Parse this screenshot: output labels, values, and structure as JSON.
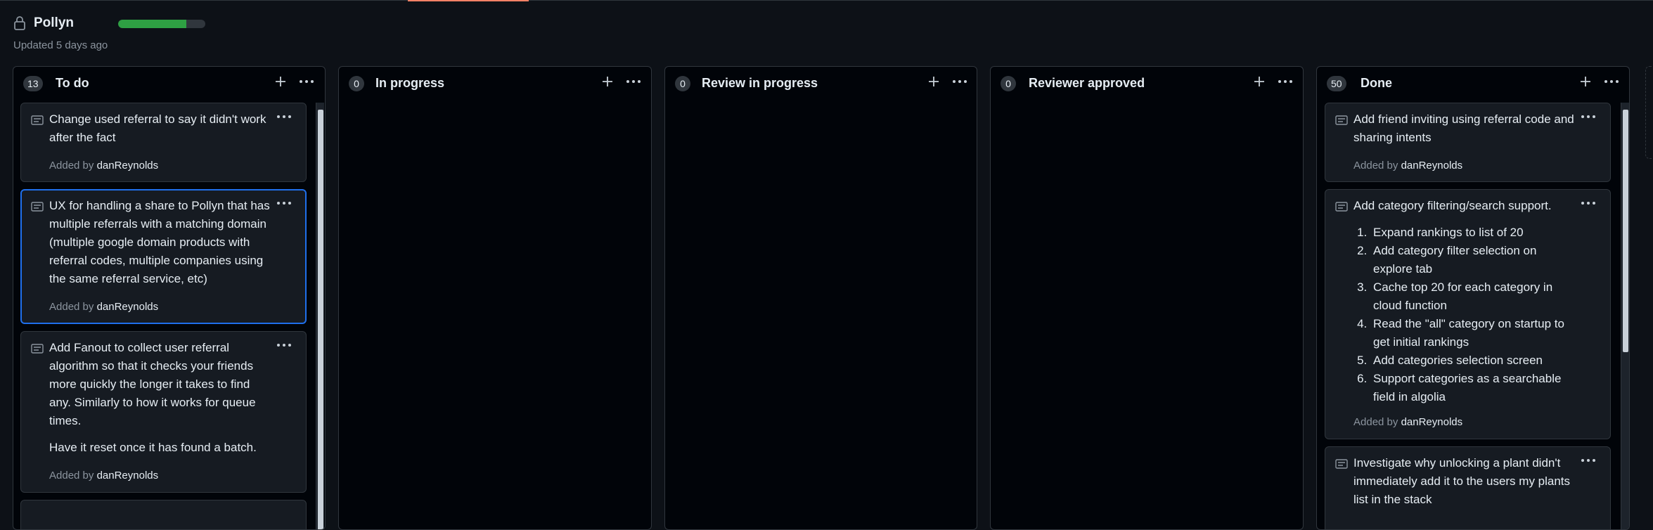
{
  "project": {
    "title": "Pollyn",
    "updated": "Updated 5 days ago",
    "progress_fraction": 0.78
  },
  "colors": {
    "background": "#0d1117",
    "column_bg": "#010409",
    "card_bg": "#161b22",
    "border": "#30363d",
    "progress_green": "#2ea043",
    "selected_border": "#1f6feb",
    "muted_text": "#8b949e"
  },
  "icons": {
    "lock": "lock-icon",
    "add": "plus-icon",
    "menu": "kebab-horizontal-icon",
    "note": "note-icon"
  },
  "columns": [
    {
      "count": "13",
      "name": "To do",
      "cards": [
        {
          "text": "Change used referral to say it didn't work after the fact",
          "added_prefix": "Added by",
          "author": "danReynolds"
        },
        {
          "text": "UX for handling a share to Pollyn that has multiple referrals with a matching domain (multiple google domain products with referral codes, multiple companies using the same referral service, etc)",
          "added_prefix": "Added by",
          "author": "danReynolds"
        },
        {
          "text": "Add Fanout to collect user referral algorithm so that it checks your friends more quickly the longer it takes to find any. Similarly to how it works for queue times.",
          "text2": "Have it reset once it has found a batch.",
          "added_prefix": "Added by",
          "author": "danReynolds"
        }
      ]
    },
    {
      "count": "0",
      "name": "In progress",
      "cards": []
    },
    {
      "count": "0",
      "name": "Review in progress",
      "cards": []
    },
    {
      "count": "0",
      "name": "Reviewer approved",
      "cards": []
    },
    {
      "count": "50",
      "name": "Done",
      "cards": [
        {
          "text": "Add friend inviting using referral code and sharing intents",
          "added_prefix": "Added by",
          "author": "danReynolds"
        },
        {
          "text": "Add category filtering/search support.",
          "list": [
            "Expand rankings to list of 20",
            "Add category filter selection on explore tab",
            "Cache top 20 for each category in cloud function",
            "Read the \"all\" category on startup to get initial rankings",
            "Add categories selection screen",
            "Support categories as a searchable field in algolia"
          ],
          "added_prefix": "Added by",
          "author": "danReynolds"
        },
        {
          "text": "Investigate why unlocking a plant didn't immediately add it to the users my plants list in the stack"
        }
      ]
    }
  ]
}
